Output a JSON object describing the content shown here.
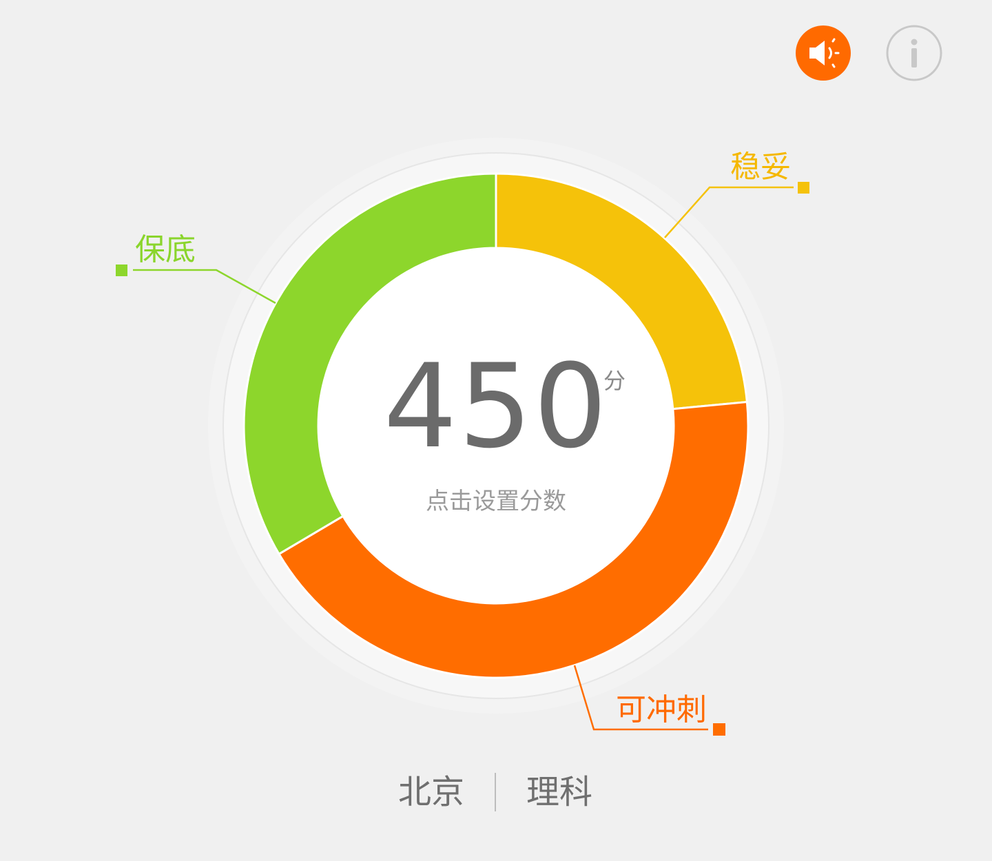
{
  "toolbar": {
    "sound_icon": "speaker-icon",
    "sound_color": "#ff6a00",
    "info_icon": "info-icon",
    "info_color": "#c8c8c8"
  },
  "score": {
    "value": "450",
    "unit": "分",
    "hint": "点击设置分数"
  },
  "chart_data": {
    "type": "pie",
    "style": "donut",
    "series": [
      {
        "name": "稳妥",
        "share": 0.235,
        "color": "#f5c20a"
      },
      {
        "name": "可冲刺",
        "share": 0.43,
        "color": "#ff6d00"
      },
      {
        "name": "保底",
        "share": 0.335,
        "color": "#8dd62c"
      }
    ]
  },
  "labels": {
    "safe": "保底",
    "stable": "稳妥",
    "reach": "可冲刺"
  },
  "footer": {
    "province": "北京",
    "subject": "理科"
  }
}
